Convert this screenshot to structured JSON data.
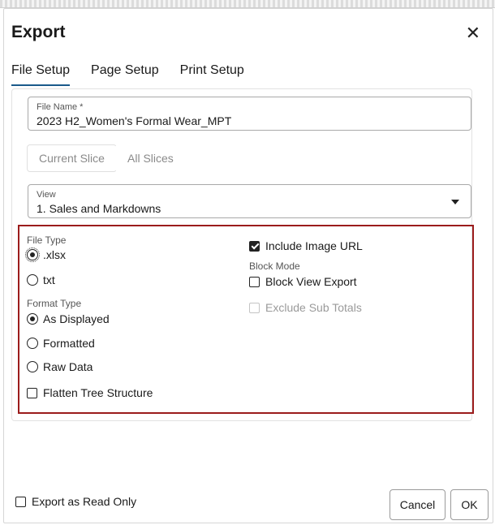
{
  "dialog": {
    "title": "Export",
    "tabs": [
      {
        "label": "File Setup",
        "active": true
      },
      {
        "label": "Page Setup",
        "active": false
      },
      {
        "label": "Print Setup",
        "active": false
      }
    ]
  },
  "file_setup": {
    "file_name": {
      "label": "File Name *",
      "value": "2023 H2_Women's Formal Wear_MPT"
    },
    "slice_buttons": {
      "current": "Current Slice",
      "all": "All Slices"
    },
    "view": {
      "label": "View",
      "value": "1. Sales and Markdowns"
    },
    "file_type": {
      "label": "File Type",
      "options": [
        {
          "label": ".xlsx",
          "selected": true
        },
        {
          "label": "txt",
          "selected": false
        }
      ]
    },
    "format_type": {
      "label": "Format Type",
      "options": [
        {
          "label": "As Displayed",
          "selected": true
        },
        {
          "label": "Formatted",
          "selected": false
        },
        {
          "label": "Raw Data",
          "selected": false
        }
      ]
    },
    "flatten_tree": {
      "label": "Flatten Tree Structure",
      "checked": false
    },
    "include_image_url": {
      "label": "Include Image URL",
      "checked": true
    },
    "block_mode": {
      "label": "Block Mode",
      "block_view_export": {
        "label": "Block View Export",
        "checked": false
      },
      "exclude_sub_totals": {
        "label": "Exclude Sub Totals",
        "checked": false,
        "disabled": true
      }
    }
  },
  "footer": {
    "export_read_only": {
      "label": "Export as Read Only",
      "checked": false
    },
    "cancel": "Cancel",
    "ok": "OK"
  },
  "colors": {
    "highlight_border": "#9b1c1c",
    "tab_underline": "#1a5a8a"
  }
}
